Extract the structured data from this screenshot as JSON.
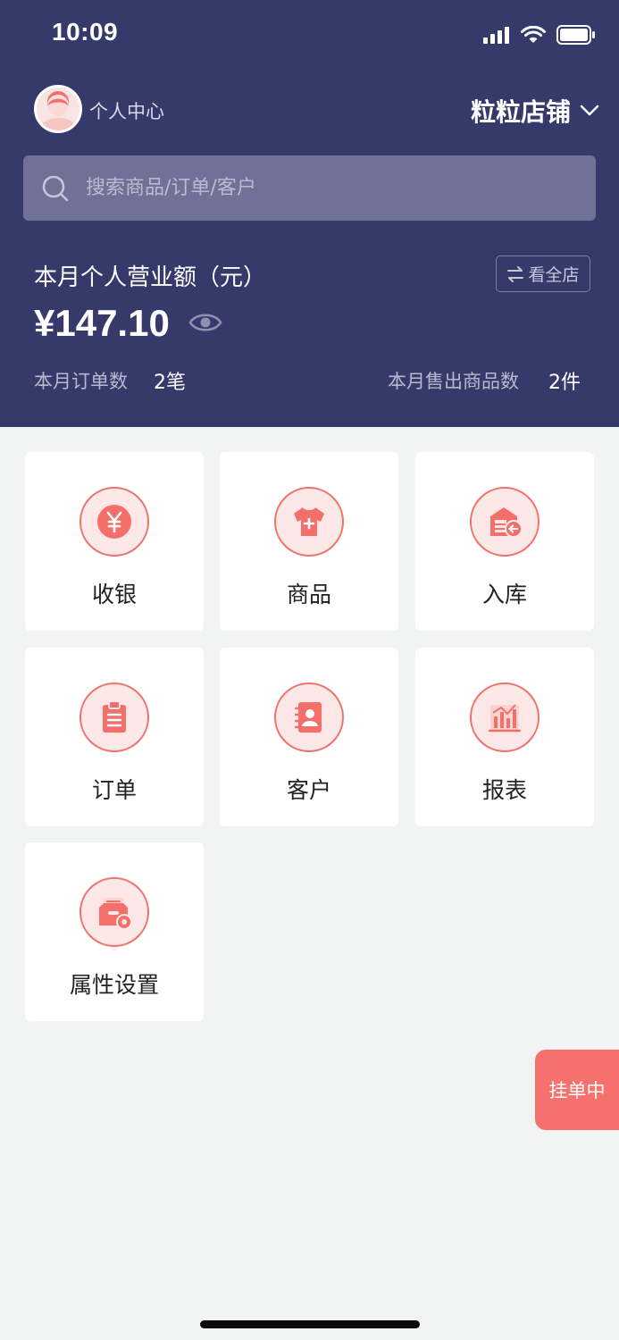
{
  "status_bar": {
    "time": "10:09"
  },
  "header": {
    "profile_label": "个人中心",
    "store_name": "粒粒店铺",
    "search_placeholder": "搜索商品/订单/客户"
  },
  "revenue": {
    "title": "本月个人营业额（元）",
    "switch_label": "看全店",
    "amount": "¥147.10",
    "orders_label": "本月订单数",
    "orders_value": "2笔",
    "items_label": "本月售出商品数",
    "items_value": "2件"
  },
  "grid": [
    {
      "label": "收银",
      "icon": "yuan-coin-icon"
    },
    {
      "label": "商品",
      "icon": "tshirt-icon"
    },
    {
      "label": "入库",
      "icon": "warehouse-in-icon"
    },
    {
      "label": "订单",
      "icon": "clipboard-icon"
    },
    {
      "label": "客户",
      "icon": "contact-book-icon"
    },
    {
      "label": "报表",
      "icon": "bar-chart-icon"
    },
    {
      "label": "属性设置",
      "icon": "box-settings-icon"
    }
  ],
  "float_tab": {
    "label": "挂单中"
  },
  "colors": {
    "header_bg": "#363a6b",
    "accent": "#f4716d",
    "page_bg": "#f2f3f3"
  }
}
